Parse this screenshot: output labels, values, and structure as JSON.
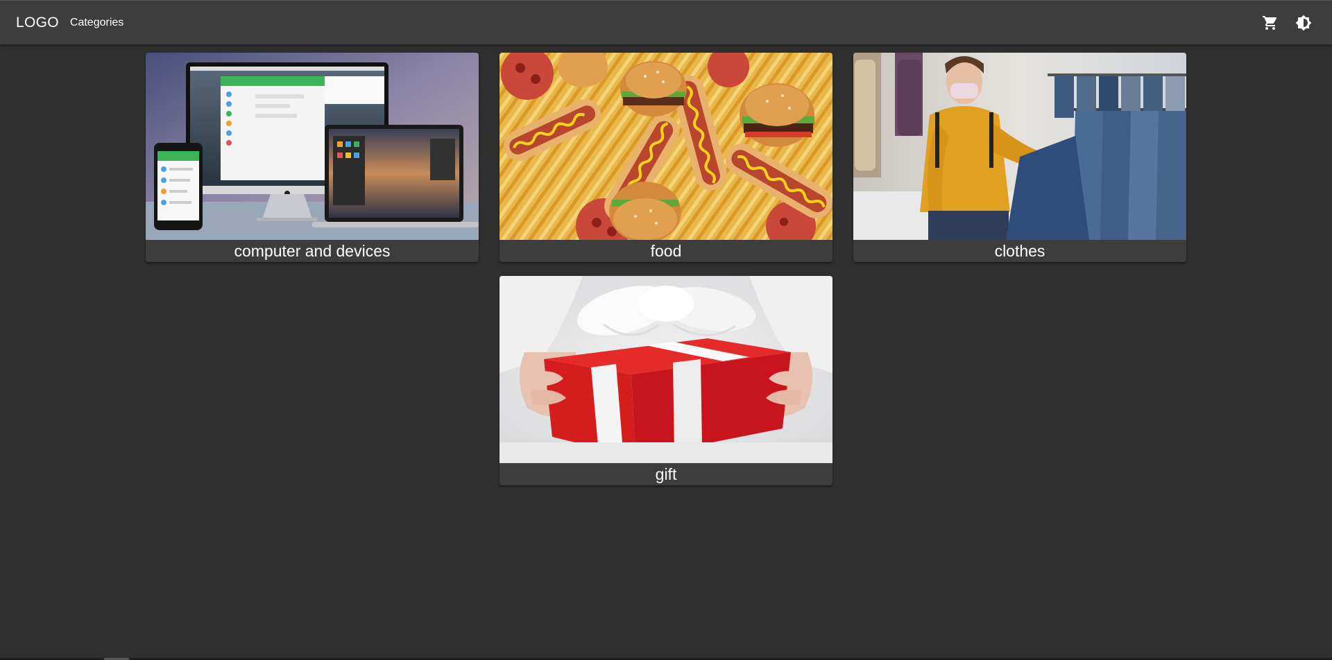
{
  "header": {
    "logo": "LOGO",
    "nav_link": "Categories",
    "icons": [
      "cart-icon",
      "brightness-icon"
    ]
  },
  "categories": [
    {
      "title": "computer and devices",
      "image": "computer-devices-image"
    },
    {
      "title": "food",
      "image": "fast-food-image"
    },
    {
      "title": "clothes",
      "image": "clothing-store-image"
    },
    {
      "title": "gift",
      "image": "gift-box-image"
    }
  ],
  "colors": {
    "background": "#2f2f2f",
    "appbar": "#3d3d3d",
    "card": "#3d3d3d",
    "text": "#ffffff"
  }
}
